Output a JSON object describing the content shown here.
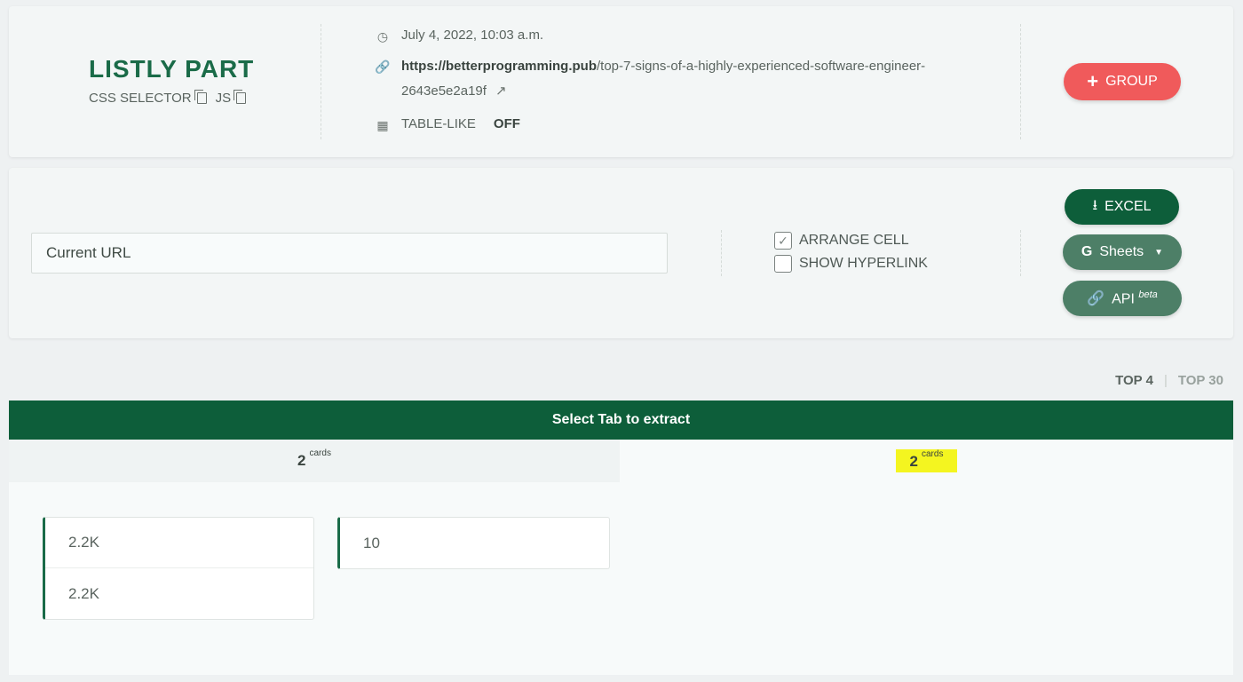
{
  "header": {
    "title": "LISTLY PART",
    "css_selector_label": "CSS SELECTOR",
    "js_label": "JS",
    "timestamp": "July 4, 2022, 10:03 a.m.",
    "url_bold": "https://betterprogramming.pub",
    "url_rest": "/top-7-signs-of-a-highly-experienced-software-engineer-2643e5e2a19f",
    "table_like_label": "TABLE-LIKE",
    "table_like_value": "OFF",
    "group_button": "GROUP"
  },
  "controls": {
    "url_input_value": "Current URL",
    "arrange_cell_label": "ARRANGE CELL",
    "arrange_cell_checked": true,
    "show_hyperlink_label": "SHOW HYPERLINK",
    "show_hyperlink_checked": false,
    "excel_button": "EXCEL",
    "sheets_button": "Sheets",
    "api_button": "API",
    "api_badge": "beta"
  },
  "top_tabs": {
    "active": "TOP 4",
    "other": "TOP 30"
  },
  "extract": {
    "bar_title": "Select Tab to extract",
    "tabs": [
      {
        "count": "2",
        "unit": "cards"
      },
      {
        "count": "2",
        "unit": "cards",
        "highlighted": true
      }
    ],
    "cards": [
      {
        "rows": [
          "2.2K",
          "2.2K"
        ]
      },
      {
        "rows": [
          "10"
        ]
      }
    ]
  },
  "colors": {
    "brand_green": "#1a6b48",
    "dark_green": "#0d5e3a",
    "muted_green": "#4d7f67",
    "group_red": "#f05a5b",
    "highlight_yellow": "#f4f520"
  },
  "icons": [
    "copy-icon",
    "clock-icon",
    "link-icon",
    "external-link-icon",
    "table-icon",
    "plus-icon",
    "download-icon",
    "google-icon",
    "api-link-icon",
    "check-icon"
  ]
}
